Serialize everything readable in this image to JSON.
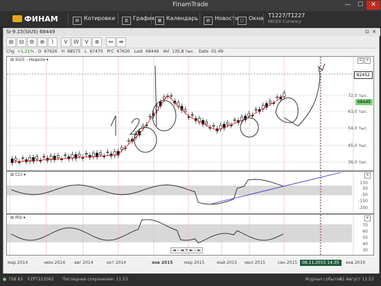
{
  "window": {
    "title": "FinamTrade",
    "min": "—",
    "max": "☐",
    "close": "✕"
  },
  "menu": {
    "logo": "ФИНАМ",
    "items": [
      {
        "label": "Котировки",
        "icon": "quotes-icon"
      },
      {
        "label": "График",
        "icon": "chart-icon"
      },
      {
        "label": "Календарь",
        "icon": "calendar-icon"
      },
      {
        "label": "Новости",
        "icon": "news-icon"
      },
      {
        "label": "Окна",
        "icon": "windows-icon"
      }
    ],
    "ticker_name": "T1227/T1227",
    "ticker_sub": "MICEX Currency"
  },
  "chart_window": {
    "title": "Si-9.15(SiU5) 68449",
    "toolbar": [
      "⊞",
      "⊟",
      "⚙",
      "⊕",
      "⌇",
      "V",
      "W",
      "V",
      "⊗",
      "↔",
      "⇹"
    ]
  },
  "quote_info": {
    "chg_label": "Chg",
    "chg": "+1,21%",
    "o_label": "O",
    "o": "67626",
    "h_label": "H",
    "h": "68575",
    "l_label": "L",
    "l": "67470",
    "prc_label": "PrC",
    "prc": "67630",
    "last_label": "Last",
    "last": "68449",
    "vol_label": "Vol",
    "vol": "135,8 тыс.",
    "date_label": "Date",
    "date": "01:49"
  },
  "main_panel": {
    "label": "SiU5 - Неделя",
    "yticks": [
      "72,0 тыс.",
      "63,0 тыс.",
      "54,0 тыс.",
      "45,0 тыс.",
      "36,0 тыс."
    ],
    "price_tag_top": "82452",
    "price_tag_last": "68449",
    "annotations": [
      "1",
      "2"
    ]
  },
  "cci_panel": {
    "label": "CCI",
    "yticks": [
      "150",
      "50",
      "-50",
      "-150",
      "-300"
    ]
  },
  "rsi_panel": {
    "label": "RSI",
    "yticks": [
      "70",
      "60",
      "50",
      "40",
      "30"
    ]
  },
  "x_axis": [
    "мар 2014",
    "июн 2014",
    "авг 2014",
    "окт 2014",
    "янв 2015",
    "мар 2015",
    "май 2015",
    "июл 2015",
    "сен 2015",
    "янв 2016"
  ],
  "crosshair_date": "08.11.2015 14:35",
  "status": {
    "speed": "758 KS",
    "account": "FZPT222062",
    "saved": "Последнее сохранение: 11:53",
    "events": "Журнал событий",
    "datetime": "21 Август 11:53"
  },
  "colors": {
    "up": "#ffffff",
    "down": "#000000",
    "ma": "#e53935",
    "trend": "#3b3bd6",
    "grid_v": "#f2b7c8",
    "band": "#d8d8d8"
  }
}
